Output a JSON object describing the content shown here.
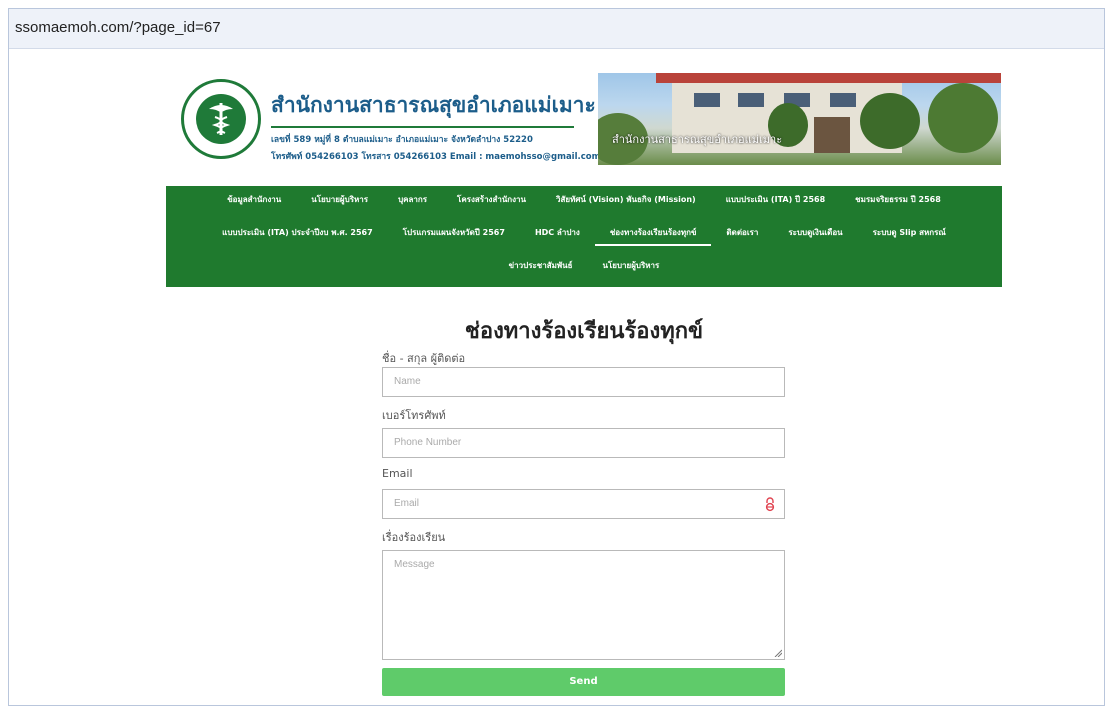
{
  "browser": {
    "url": "ssomaemoh.com/?page_id=67"
  },
  "header": {
    "org_name": "สำนักงานสาธารณสุขอำเภอแม่เมาะ",
    "address": "เลขที่ 589 หมู่ที่ 8 ตำบลแม่เมาะ อำเภอแม่เมาะ จังหวัดลำปาง 52220",
    "contact": "โทรศัพท์ 054266103  โทรสาร 054266103  Email : maemohsso@gmail.com",
    "photo_caption": "สำนักงานสาธารณสุขอำเภอแม่เมาะ"
  },
  "nav": {
    "rows": [
      [
        "ข้อมูลสำนักงาน",
        "นโยบายผู้บริหาร",
        "บุคลากร",
        "โครงสร้างสำนักงาน",
        "วิสัยทัศน์ (Vision) พันธกิจ (Mission)",
        "แบบประเมิน (ITA) ปี 2568",
        "ชมรมจริยธรรม ปี 2568"
      ],
      [
        "แบบประเมิน (ITA) ประจำปีงบ พ.ศ. 2567",
        "โปรแกรมแผนจังหวัดปี 2567",
        "HDC ลำปาง",
        "ช่องทางร้องเรียนร้องทุกข์",
        "ติดต่อเรา",
        "ระบบดูเงินเดือน",
        "ระบบดู Slip สหกรณ์"
      ],
      [
        "ข่าวประชาสัมพันธ์",
        "นโยบายผู้บริหาร"
      ]
    ],
    "active": "ช่องทางร้องเรียนร้องทุกข์"
  },
  "page": {
    "title": "ช่องทางร้องเรียนร้องทุกข์"
  },
  "form": {
    "name_label": "ชื่อ - สกุล ผู้ติดต่อ",
    "name_placeholder": "Name",
    "phone_label": "เบอร์โทรศัพท์",
    "phone_placeholder": "Phone Number",
    "email_label": "Email",
    "email_placeholder": "Email",
    "message_label": "เรื่องร้องเรียน",
    "message_placeholder": "Message",
    "send_label": "Send"
  },
  "colors": {
    "nav_bg": "#1f7a2e",
    "send_bg": "#5fcb6a",
    "org_text": "#1c5d8a"
  }
}
